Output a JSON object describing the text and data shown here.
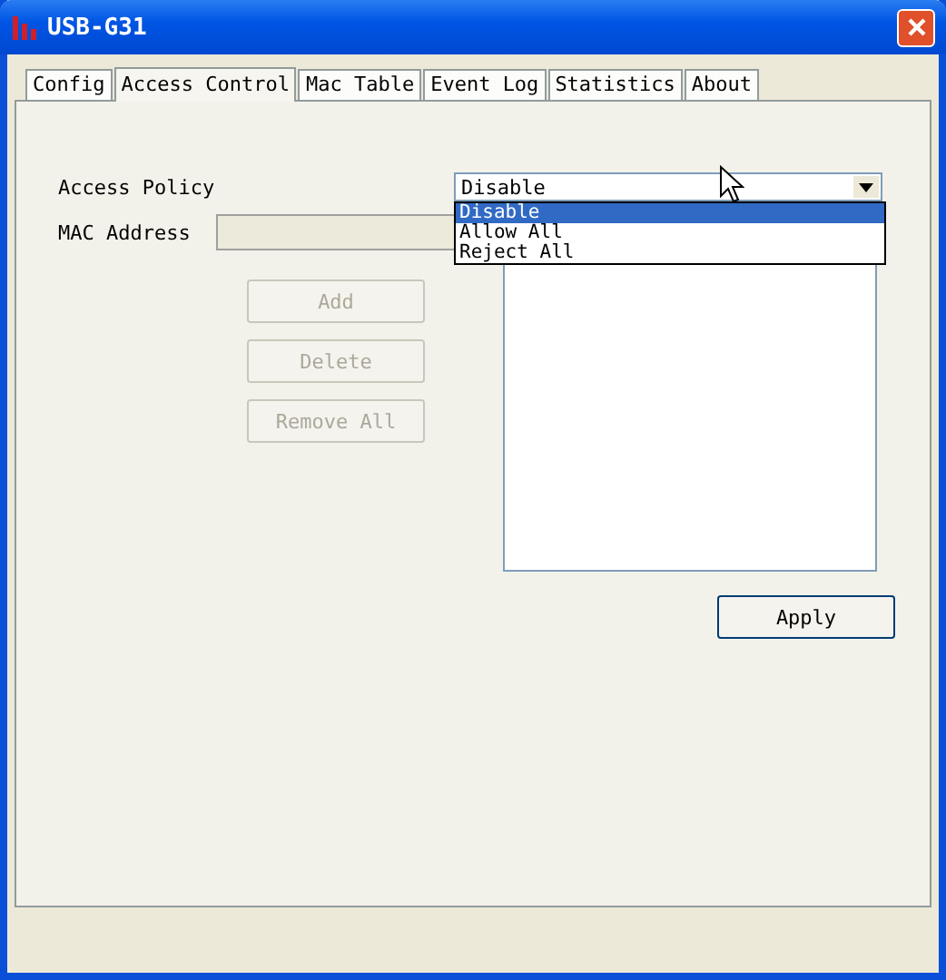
{
  "window": {
    "title": "USB-G31"
  },
  "tabs": [
    {
      "label": "Config",
      "selected": false
    },
    {
      "label": "Access Control",
      "selected": true
    },
    {
      "label": "Mac Table",
      "selected": false
    },
    {
      "label": "Event Log",
      "selected": false
    },
    {
      "label": "Statistics",
      "selected": false
    },
    {
      "label": "About",
      "selected": false
    }
  ],
  "access_policy": {
    "label": "Access Policy",
    "value": "Disable",
    "expanded": true,
    "options": [
      {
        "label": "Disable",
        "selected": true
      },
      {
        "label": "Allow All",
        "selected": false
      },
      {
        "label": "Reject All",
        "selected": false
      }
    ]
  },
  "mac_address": {
    "label": "MAC Address",
    "disabled": true
  },
  "buttons": [
    {
      "label": "Add",
      "disabled": true
    },
    {
      "label": "Delete",
      "disabled": true
    },
    {
      "label": "Remove All",
      "disabled": true
    }
  ],
  "apply_button": {
    "label": "Apply",
    "disabled": false
  }
}
